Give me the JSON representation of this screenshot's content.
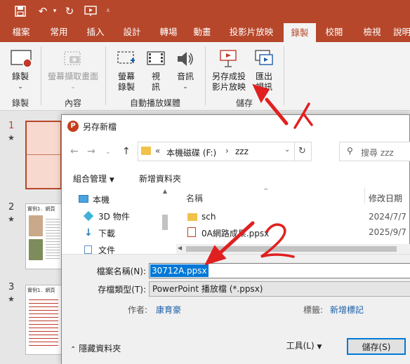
{
  "tabs": [
    "檔案",
    "常用",
    "插入",
    "設計",
    "轉場",
    "動畫",
    "投影片放映",
    "錄製",
    "校閱",
    "檢視",
    "說明"
  ],
  "active_tab": "錄製",
  "ribbon": {
    "record": "錄製",
    "screenshot_capture": "螢幕擷取畫面",
    "screen_record_line1": "螢幕",
    "screen_record_line2": "錄製",
    "video_line1": "視",
    "video_line2": "訊",
    "audio": "音訊",
    "save_as_show_line1": "另存成投",
    "save_as_show_line2": "影片放映",
    "export_video_line1": "匯出",
    "export_video_line2": "視訊",
    "groups": {
      "record": "錄製",
      "content": "內容",
      "auto_play": "自動播放媒體",
      "save": "儲存"
    }
  },
  "slides": [
    {
      "number": "1",
      "star": "★"
    },
    {
      "number": "2",
      "star": "★",
      "caption": "實例1．網頁"
    },
    {
      "number": "3",
      "star": "★",
      "caption": "實例1．網頁"
    }
  ],
  "dialog": {
    "title": "另存新檔",
    "address": {
      "prefix": "«",
      "drive": "本機磁碟 (F:)",
      "separator": "›",
      "folder": "zzz"
    },
    "search_placeholder": "搜尋 zzz",
    "toolbar": {
      "organize": "組合管理",
      "new_folder": "新增資料夾"
    },
    "nav_items": [
      "本機",
      "3D 物件",
      "下載",
      "文件"
    ],
    "columns": {
      "name": "名稱",
      "modified": "修改日期"
    },
    "files": [
      {
        "name": "sch",
        "modified": "2024/7/7"
      },
      {
        "name": "0A網路成果.ppsx",
        "modified": "2025/9/7"
      }
    ],
    "filename_label": "檔案名稱(N):",
    "filename_value": "30712A.ppsx",
    "filetype_label": "存檔類型(T):",
    "filetype_value": "PowerPoint 播放檔 (*.ppsx)",
    "author_label": "作者:",
    "author_value": "康育豪",
    "tags_label": "標籤:",
    "tags_value": "新增標記",
    "hide_folders": "隱藏資料夾",
    "tools": "工具(L)",
    "save": "儲存(S)"
  },
  "annotations": {
    "step1": "1",
    "step2": "2",
    "color": "#e02020"
  },
  "colors": {
    "accent": "#b7472a",
    "selection": "#0078d7",
    "link": "#1a5ea8"
  }
}
